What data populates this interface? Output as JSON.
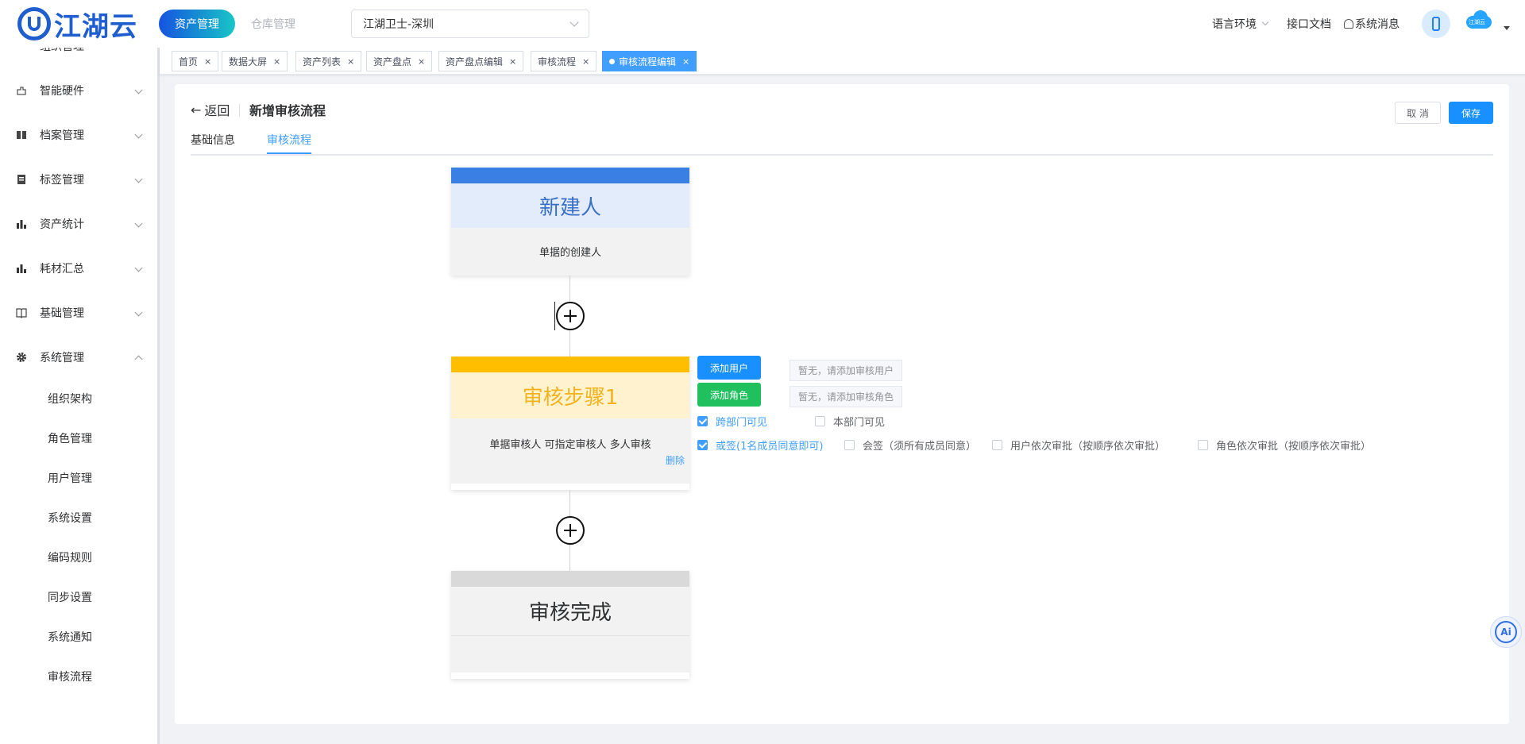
{
  "header": {
    "logo_text": "江湖云",
    "tabs": [
      {
        "label": "资产管理"
      },
      {
        "label": "仓库管理"
      }
    ],
    "org_select": "江湖卫士-深圳",
    "language": "语言环境",
    "api_doc": "接口文档",
    "system_messages": "系统消息",
    "cloud_text": "江湖云"
  },
  "sidebar": {
    "items": [
      {
        "label": "组织管理"
      },
      {
        "label": "智能硬件"
      },
      {
        "label": "档案管理"
      },
      {
        "label": "标签管理"
      },
      {
        "label": "资产统计"
      },
      {
        "label": "耗材汇总"
      },
      {
        "label": "基础管理"
      },
      {
        "label": "系统管理"
      }
    ],
    "sub_items": [
      {
        "label": "组织架构"
      },
      {
        "label": "角色管理"
      },
      {
        "label": "用户管理"
      },
      {
        "label": "系统设置"
      },
      {
        "label": "编码规则"
      },
      {
        "label": "同步设置"
      },
      {
        "label": "系统通知"
      },
      {
        "label": "审核流程"
      }
    ]
  },
  "tags": [
    {
      "label": "首页"
    },
    {
      "label": "数据大屏"
    },
    {
      "label": "资产列表"
    },
    {
      "label": "资产盘点"
    },
    {
      "label": "资产盘点编辑"
    },
    {
      "label": "审核流程"
    },
    {
      "label": "审核流程编辑"
    }
  ],
  "tag_close": "×",
  "page": {
    "back_label": "返回",
    "title": "新增审核流程",
    "cancel_label": "取 消",
    "save_label": "保存",
    "tabs": [
      {
        "label": "基础信息"
      },
      {
        "label": "审核流程"
      }
    ]
  },
  "flow": {
    "start_node": {
      "title": "新建人",
      "desc": "单据的创建人"
    },
    "step_node": {
      "title": "审核步骤1",
      "desc": "单据审核人 可指定审核人 多人审核",
      "delete_label": "删除"
    },
    "end_node": {
      "title": "审核完成"
    },
    "config": {
      "add_user_label": "添加用户",
      "add_role_label": "添加角色",
      "no_user": "暂无，请添加审核用户",
      "no_role": "暂无，请添加审核角色",
      "cross_dept": "跨部门可见",
      "own_dept": "本部门可见",
      "or_sign": "或签(1名成员同意即可)",
      "co_sign": "会签（须所有成员同意）",
      "user_sequential": "用户依次审批（按顺序依次审批）",
      "role_sequential": "角色依次审批（按顺序依次审批）"
    }
  },
  "ai_label": "Ai"
}
